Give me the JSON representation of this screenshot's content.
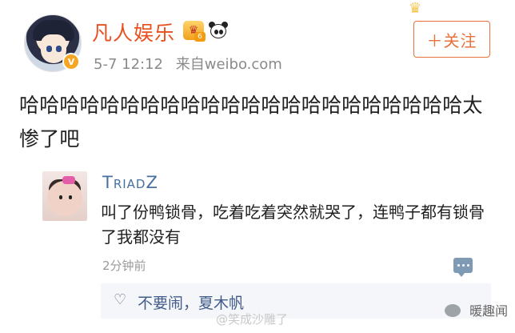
{
  "post": {
    "author": "凡人娱乐",
    "crown_level": "6",
    "timestamp": "5-7 12:12",
    "source": "来自weibo.com",
    "follow_label": "＋关注",
    "text": "哈哈哈哈哈哈哈哈哈哈哈哈哈哈哈哈哈哈哈哈哈哈太惨了吧"
  },
  "repost": {
    "author": "TriadZ",
    "text": "叫了份鸭锁骨，吃着吃着突然就哭了，连鸭子都有锁骨了我都没有",
    "time": "2分钟前",
    "likes": "不要闹，夏木帆"
  },
  "watermarks": {
    "center": "@笑成沙雕了",
    "brand": "暖趣闻"
  }
}
